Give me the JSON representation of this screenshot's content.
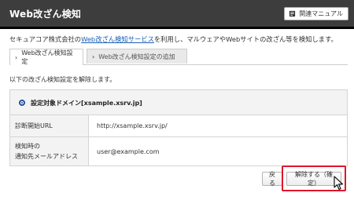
{
  "header": {
    "title": "Web改ざん検知",
    "manual_label": "関連マニュアル"
  },
  "intro": {
    "prefix": "セキュアコア株式会社の",
    "link": "Web改ざん検知サービス",
    "suffix": "を利用し、マルウェアやWebサイトの改ざん等を検知します。"
  },
  "tabs": [
    {
      "label": "Web改ざん検知設定",
      "active": true
    },
    {
      "label": "Web改ざん検知設定の追加",
      "active": false
    }
  ],
  "message": "以下の改ざん検知設定を解除します。",
  "panel": {
    "domain_label": "設定対象ドメイン[xsample.xsrv.jp]",
    "rows": [
      {
        "label_lines": [
          "診断開始URL"
        ],
        "value": "http://xsample.xsrv.jp/"
      },
      {
        "label_lines": [
          "検知時の",
          "通知先メールアドレス"
        ],
        "value": "user@example.com"
      }
    ]
  },
  "buttons": {
    "back": "戻る",
    "confirm": "解除する（確定）"
  },
  "colors": {
    "header_bg": "#3d3d3d",
    "link": "#1a5fb4",
    "highlight": "#e0162b"
  }
}
